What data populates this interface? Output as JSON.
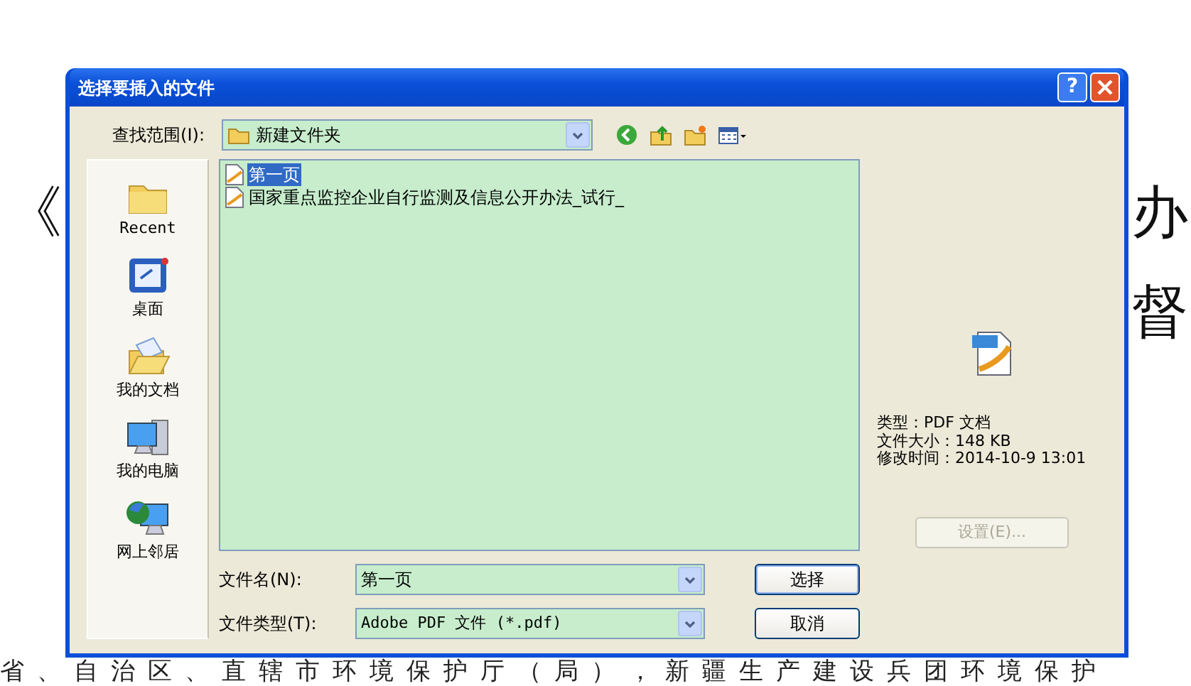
{
  "background_document": {
    "left_fragment": "《",
    "right_fragments": [
      "办",
      "督"
    ],
    "bottom_line": "省、自治区、直辖市环境保护厅（局），新疆生产建设兵团环境保护"
  },
  "dialog": {
    "title": "选择要插入的文件",
    "help_button": "?",
    "look_in": {
      "label": "查找范围(I):",
      "value": "新建文件夹"
    },
    "toolbar": [
      {
        "kind": "back"
      },
      {
        "kind": "up"
      },
      {
        "kind": "new_folder"
      },
      {
        "kind": "views"
      }
    ],
    "places": [
      {
        "kind": "recent",
        "label": "Recent"
      },
      {
        "kind": "desktop",
        "label": "桌面"
      },
      {
        "kind": "documents",
        "label": "我的文档"
      },
      {
        "kind": "computer",
        "label": "我的电脑"
      },
      {
        "kind": "network",
        "label": "网上邻居"
      }
    ],
    "files": [
      {
        "name": "第一页",
        "selected": true
      },
      {
        "name": "国家重点监控企业自行监测及信息公开办法_试行_",
        "selected": false
      }
    ],
    "preview": {
      "details": [
        "类型：PDF 文档",
        "文件大小：148 KB",
        "修改时间：2014-10-9 13:01"
      ],
      "settings_button": {
        "label": "设置(E)...",
        "disabled": true
      }
    },
    "file_name": {
      "label": "文件名(N):",
      "value": "第一页"
    },
    "file_type": {
      "label": "文件类型(T):",
      "value": "Adobe PDF 文件 (*.pdf)"
    },
    "buttons": [
      {
        "label": "选择",
        "kind": "default"
      },
      {
        "label": "取消",
        "kind": "normal"
      }
    ]
  }
}
